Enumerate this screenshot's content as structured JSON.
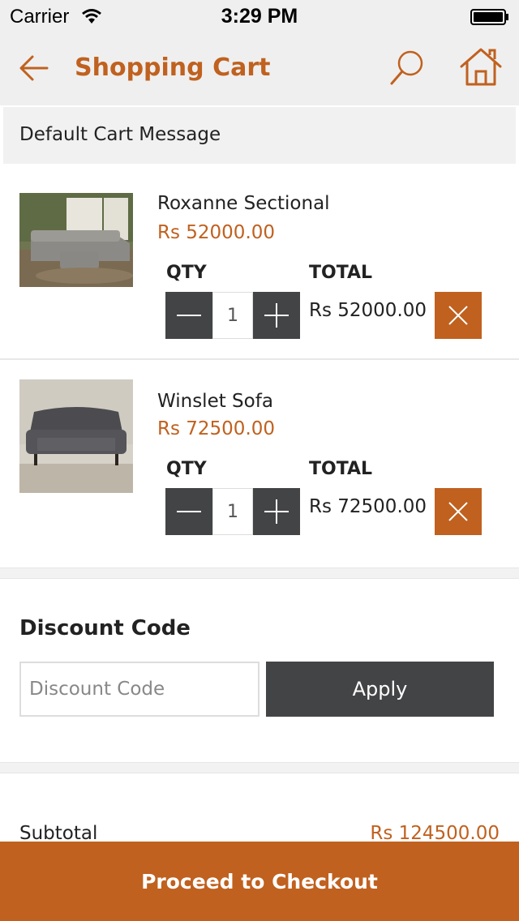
{
  "status_bar": {
    "carrier": "Carrier",
    "time": "3:29 PM"
  },
  "nav": {
    "title": "Shopping Cart"
  },
  "cart_message": "Default Cart Message",
  "items": [
    {
      "name": "Roxanne Sectional",
      "price": "Rs 52000.00",
      "qty_label": "QTY",
      "total_label": "TOTAL",
      "quantity": "1",
      "line_total": "Rs 52000.00"
    },
    {
      "name": "Winslet Sofa",
      "price": "Rs 72500.00",
      "qty_label": "QTY",
      "total_label": "TOTAL",
      "quantity": "1",
      "line_total": "Rs 72500.00"
    }
  ],
  "discount": {
    "heading": "Discount Code",
    "placeholder": "Discount Code",
    "apply_label": "Apply"
  },
  "summary": {
    "subtotal_label": "Subtotal",
    "subtotal_value": "Rs 124500.00"
  },
  "checkout": {
    "label": "Proceed to Checkout"
  },
  "colors": {
    "accent": "#c0611f",
    "dark_button": "#434446",
    "nav_background": "#efefef"
  },
  "icons": [
    "wifi-icon",
    "battery-icon",
    "back-arrow-icon",
    "search-icon",
    "home-icon",
    "minus-icon",
    "plus-icon",
    "close-icon"
  ]
}
